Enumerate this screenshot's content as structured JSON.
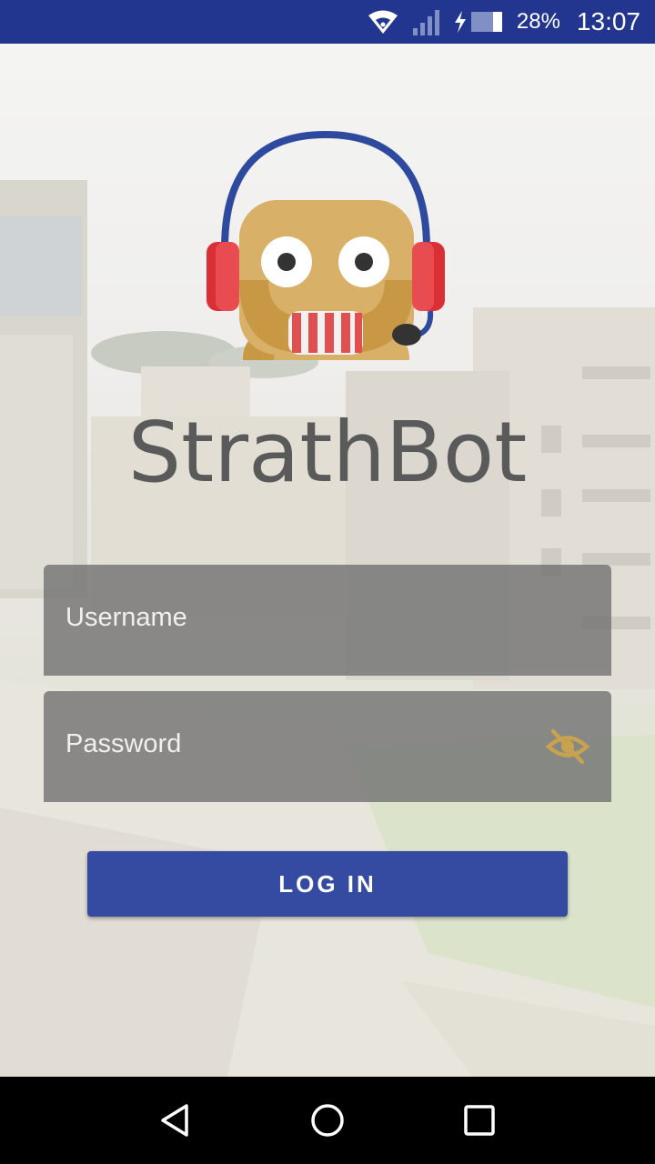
{
  "status_bar": {
    "battery_percent": "28%",
    "time": "13:07"
  },
  "app": {
    "title": "StrathBot",
    "logo_icon": "robot-headset-icon"
  },
  "form": {
    "username_placeholder": "Username",
    "password_placeholder": "Password",
    "visibility_icon": "eye-off-icon",
    "login_label": "LOG IN"
  },
  "colors": {
    "status_bar": "#23368f",
    "button": "#344ba1",
    "eye_icon": "#c7a24f",
    "title": "#5a5a5a"
  },
  "navigation": {
    "back_icon": "back-triangle-icon",
    "home_icon": "home-circle-icon",
    "recents_icon": "recents-square-icon"
  }
}
